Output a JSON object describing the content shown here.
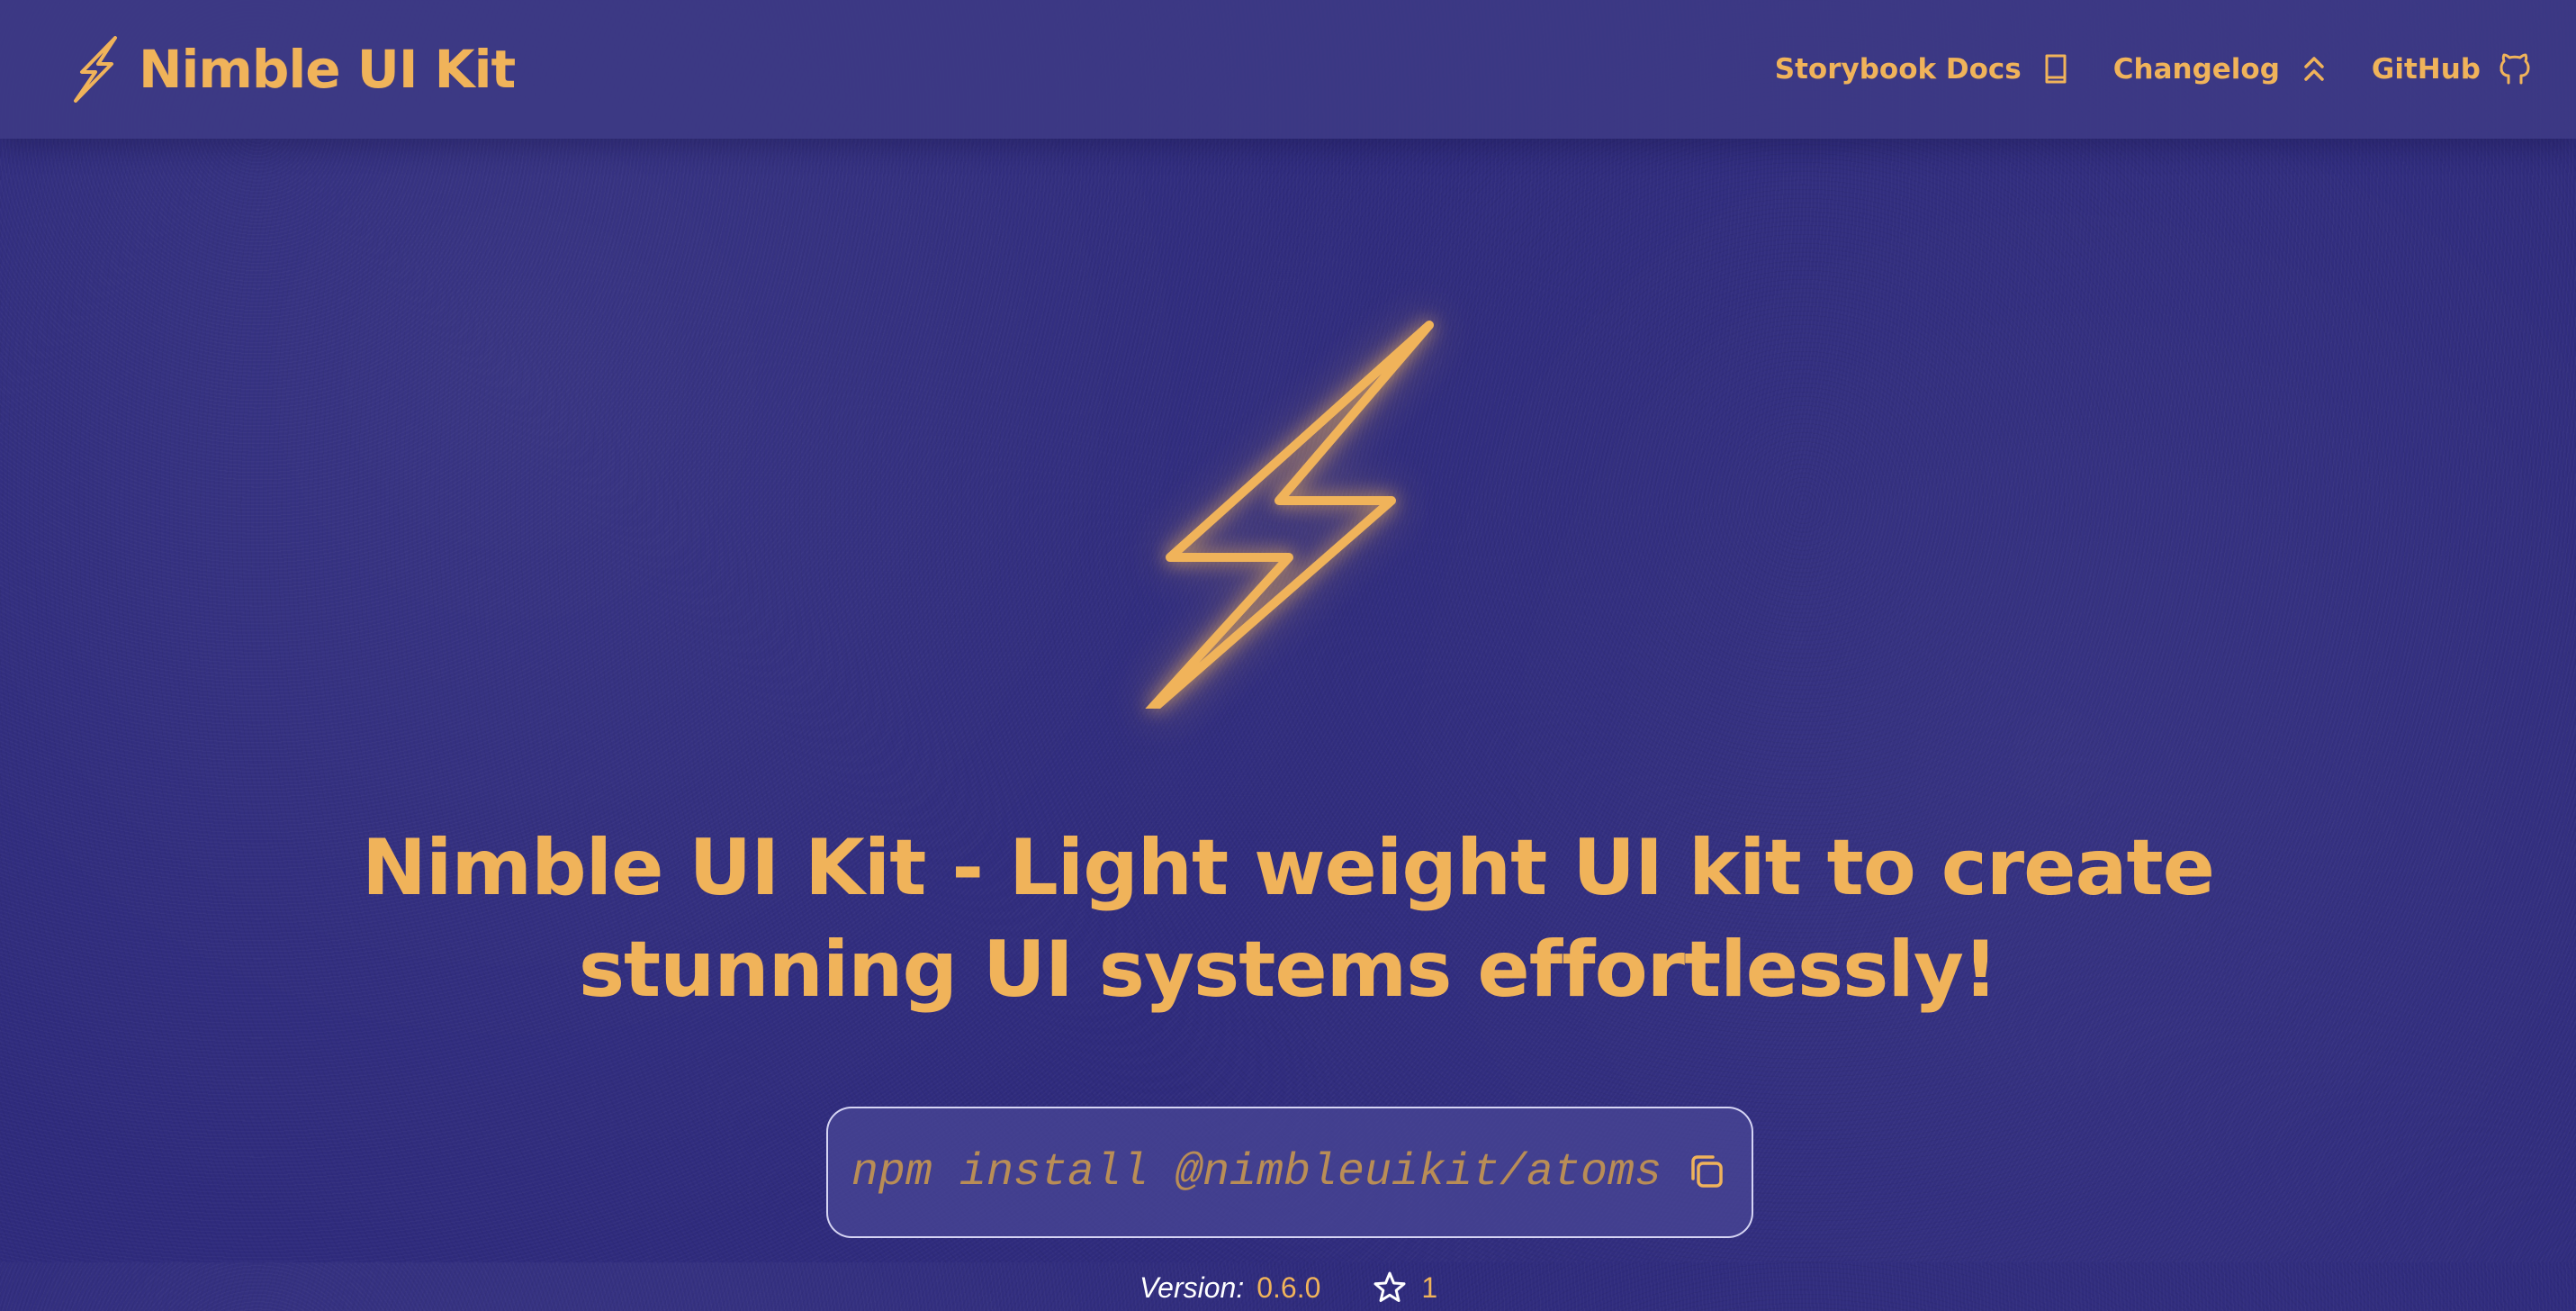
{
  "colors": {
    "background": "#2f2b7d",
    "header": "#3d3a84",
    "accent": "#f0b35a",
    "command": "#b98d56",
    "text_light": "#ffffff"
  },
  "header": {
    "logo_icon": "lightning-bolt-icon",
    "brand": "Nimble UI Kit",
    "nav": [
      {
        "label": "Storybook Docs",
        "icon": "book-icon"
      },
      {
        "label": "Changelog",
        "icon": "double-chevron-up-icon"
      },
      {
        "label": "GitHub",
        "icon": "github-icon"
      }
    ]
  },
  "hero": {
    "icon": "lightning-bolt-icon",
    "headline": "Nimble UI Kit - Light weight UI kit to create stunning UI systems effortlessly!",
    "install_command": "npm install @nimbleuikit/atoms",
    "copy_icon": "copy-icon",
    "version_label": "Version:",
    "version": "0.6.0",
    "stars_icon": "star-icon",
    "stars": "1"
  }
}
